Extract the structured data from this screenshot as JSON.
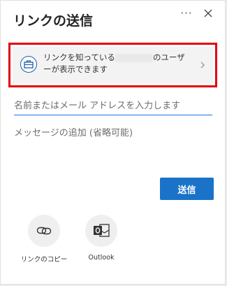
{
  "dialog": {
    "title": "リンクの送信",
    "more_icon": "more-options-icon",
    "close_icon": "close-icon"
  },
  "link_settings": {
    "text_prefix": "リンクを知っている",
    "text_suffix": "のユーザーが表示できます",
    "icon": "building-icon",
    "chevron_icon": "chevron-right-icon",
    "highlight_color": "#e3000f"
  },
  "recipients": {
    "placeholder": "名前またはメール アドレスを入力します"
  },
  "message": {
    "placeholder": "メッセージの追加 (省略可能)"
  },
  "send_button": {
    "label": "送信",
    "color": "#1a73c8"
  },
  "share_options": [
    {
      "label": "リンクのコピー",
      "icon": "link-icon"
    },
    {
      "label": "Outlook",
      "icon": "outlook-icon"
    }
  ]
}
